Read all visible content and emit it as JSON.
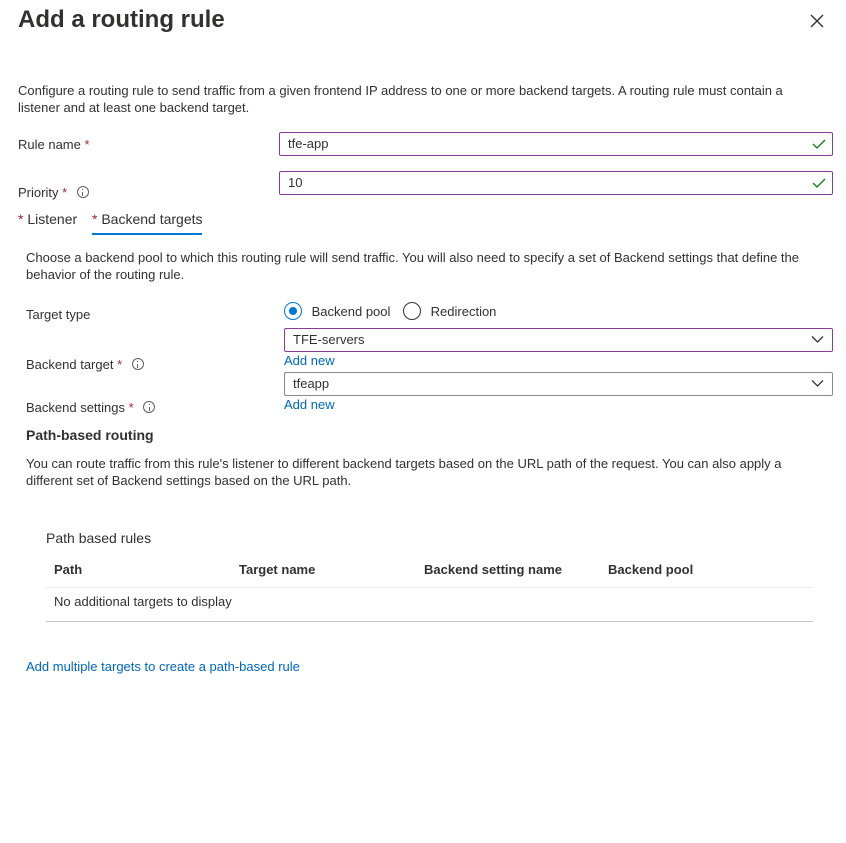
{
  "header": {
    "title": "Add a routing rule",
    "close_icon": "close-icon"
  },
  "description": "Configure a routing rule to send traffic from a given frontend IP address to one or more backend targets. A routing rule must contain a listener and at least one backend target.",
  "form": {
    "rule_name_label": "Rule name",
    "rule_name_value": "tfe-app",
    "priority_label": "Priority",
    "priority_value": "10",
    "required_mark": "*"
  },
  "tabs": [
    {
      "label": "Listener",
      "selected": false
    },
    {
      "label": "Backend targets",
      "selected": true
    }
  ],
  "backend": {
    "description": "Choose a backend pool to which this routing rule will send traffic. You will also need to specify a set of Backend settings that define the behavior of the routing rule.",
    "target_type_label": "Target type",
    "radio_options": [
      "Backend pool",
      "Redirection"
    ],
    "radio_selected": "Backend pool",
    "backend_target_label": "Backend target",
    "backend_target_value": "TFE-servers",
    "add_new_label": "Add new",
    "backend_settings_label": "Backend settings",
    "backend_settings_value": "tfeapp"
  },
  "path_routing": {
    "title": "Path-based routing",
    "description": "You can route traffic from this rule's listener to different backend targets based on the URL path of the request. You can also apply a different set of Backend settings based on the URL path.",
    "table_title": "Path based rules",
    "columns": [
      "Path",
      "Target name",
      "Backend setting name",
      "Backend pool"
    ],
    "empty_text": "No additional targets to display",
    "add_link": "Add multiple targets to create a path-based rule"
  },
  "colors": {
    "accent": "#0078d4",
    "link": "#0067b8",
    "valid_border": "#8a3a9e",
    "valid_check": "#107c10",
    "required": "#a4262c"
  }
}
